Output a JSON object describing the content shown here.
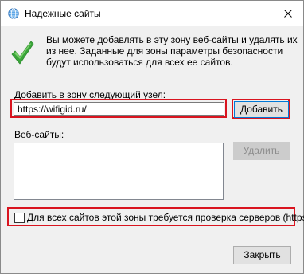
{
  "window": {
    "title": "Надежные сайты",
    "title_icon": "globe-icon",
    "close_icon": "close-icon"
  },
  "info": {
    "icon": "green-check-icon",
    "description": "Вы можете добавлять в эту зону  веб-сайты и удалять их из нее. Заданные для зоны параметры безопасности будут использоваться для всех ее сайтов."
  },
  "add_site": {
    "label": "Добавить в зону следующий узел:",
    "url_value": "https://wifigid.ru/",
    "add_button": "Добавить"
  },
  "sites": {
    "label": "Веб-сайты:",
    "items": [],
    "remove_button": "Удалить"
  },
  "https_check": {
    "label": "Для всех сайтов этой зоны требуется проверка серверов (https:)",
    "checked": false
  },
  "footer": {
    "close_button": "Закрыть"
  },
  "colors": {
    "highlight": "#d9141f",
    "accent": "#0078d7",
    "check_green": "#3aa53a"
  }
}
